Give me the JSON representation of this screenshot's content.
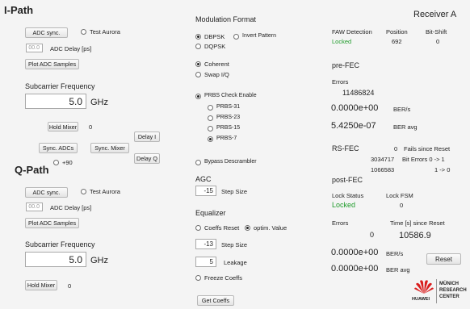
{
  "ipath": {
    "title": "I-Path",
    "adc_sync": "ADC sync.",
    "test_aurora": "Test Aurora",
    "adc_delay_value": "00.0",
    "adc_delay_label": "ADC Delay [ps]",
    "plot_adc": "Plot ADC Samples",
    "subcarrier_label": "Subcarrier Frequency",
    "subcarrier_value": "5.0",
    "unit": "GHz",
    "hold_mixer": "Hold Mixer",
    "hold_mixer_value": "0",
    "delay_i": "Delay I",
    "sync_adcs": "Sync. ADCs",
    "sync_mixer": "Sync. Mixer",
    "delay_q": "Delay Q",
    "plus90": "+90"
  },
  "qpath": {
    "title": "Q-Path",
    "adc_sync": "ADC sync.",
    "test_aurora": "Test Aurora",
    "adc_delay_value": "00.0",
    "adc_delay_label": "ADC Delay [ps]",
    "plot_adc": "Plot ADC Samples",
    "subcarrier_label": "Subcarrier Frequency",
    "subcarrier_value": "5.0",
    "unit": "GHz",
    "hold_mixer": "Hold Mixer",
    "hold_mixer_value": "0"
  },
  "modulation": {
    "title": "Modulation Format",
    "dbpsk": "DBPSK",
    "invert_pattern": "Invert Pattern",
    "dqpsk": "DQPSK",
    "coherent": "Coherent",
    "swap_iq": "Swap I/Q",
    "prbs_enable": "PRBS Check Enable",
    "prbs31": "PRBS-31",
    "prbs23": "PRBS-23",
    "prbs15": "PRBS-15",
    "prbs7": "PRBS-7",
    "bypass": "Bypass Descrambler"
  },
  "agc": {
    "title": "AGC",
    "step_value": "-15",
    "step_label": "Step Size"
  },
  "equalizer": {
    "title": "Equalizer",
    "coeffs_reset": "Coeffs Reset",
    "optim_value": "optim. Value",
    "step_value": "-13",
    "step_label": "Step Size",
    "leakage_value": "5",
    "leakage_label": "Leakage",
    "freeze": "Freeze Coeffs",
    "get_coeffs": "Get Coeffs"
  },
  "receiver": {
    "title": "Receiver A",
    "faw_label": "FAW Detection",
    "faw_value": "Locked",
    "position_label": "Position",
    "position_value": "692",
    "bitshift_label": "Bit-Shift",
    "bitshift_value": "0",
    "prefec_title": "pre-FEC",
    "errors_label": "Errors",
    "errors_value": "11486824",
    "ber_s_value": "0.0000e+00",
    "ber_s_label": "BER/s",
    "ber_avg_value": "5.4250e-07",
    "ber_avg_label": "BER avg",
    "rsfec_title": "RS-FEC",
    "fails_value": "0",
    "fails_label": "Fails since Reset",
    "bit_errors_value": "3034717",
    "bit_errors_label": "Bit Errors  0 -> 1",
    "bit_errors2_value": "1066583",
    "bit_errors2_label": "1 -> 0",
    "postfec_title": "post-FEC",
    "lock_status_label": "Lock Status",
    "lock_status_value": "Locked",
    "lock_fsm_label": "Lock FSM",
    "lock_fsm_value": "0",
    "post_errors_label": "Errors",
    "post_errors_value": "0",
    "time_label": "Time [s] since Reset",
    "time_value": "10586.9",
    "post_ber_s_value": "0.0000e+00",
    "post_ber_s_label": "BER/s",
    "post_ber_avg_value": "0.0000e+00",
    "post_ber_avg_label": "BER avg",
    "reset": "Reset"
  },
  "logo": {
    "brand": "HUAWEI",
    "line1": "MÜNICH",
    "line2": "RESEARCH",
    "line3": "CENTER"
  },
  "colors": {
    "locked": "#1e9b2a",
    "logo_red": "#d91d1d"
  }
}
